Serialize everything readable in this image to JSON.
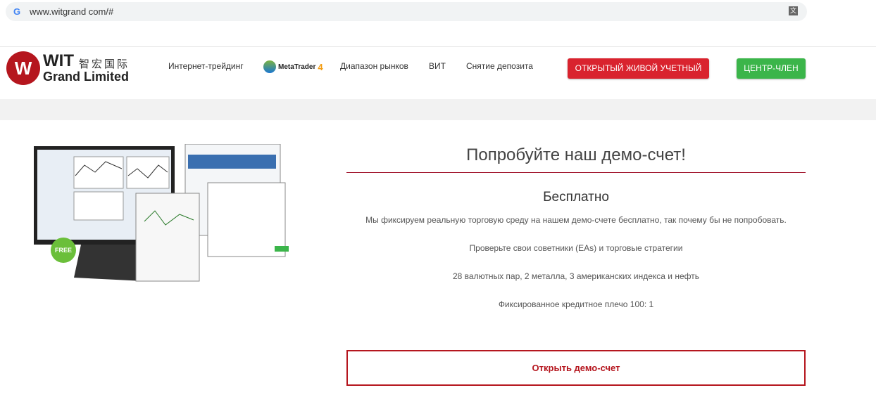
{
  "browser": {
    "url": "www.witgrand com/#"
  },
  "logo": {
    "wit": "WIT",
    "chinese": "智宏国际",
    "grand": "Grand Limited",
    "mark": "W"
  },
  "nav": {
    "items": [
      "Интернет-трейдинг",
      "Диапазон рынков",
      "ВИТ",
      "Снятие депозита"
    ],
    "metatrader": "MetaTrader",
    "metatrader_version": "4"
  },
  "buttons": {
    "live": "ОТКРЫТЫЙ ЖИВОЙ УЧЕТНЫЙ",
    "member": "ЦЕНТР-ЧЛЕН",
    "demo": "Открыть демо-счет"
  },
  "main": {
    "title": "Попробуйте наш демо-счет!",
    "subtitle": "Бесплатно",
    "badge": "FREE",
    "paragraphs": [
      "Мы фиксируем реальную торговую среду на нашем демо-счете бесплатно, так почему бы не попробовать.",
      "Проверьте свои советники (EAs) и торговые стратегии",
      "28 валютных пар, 2 металла, 3 американских индекса и нефть",
      "Фиксированное кредитное плечо 100: 1"
    ]
  },
  "colors": {
    "red": "#d9232e",
    "green": "#3bb54a",
    "brand": "#b5161e"
  }
}
